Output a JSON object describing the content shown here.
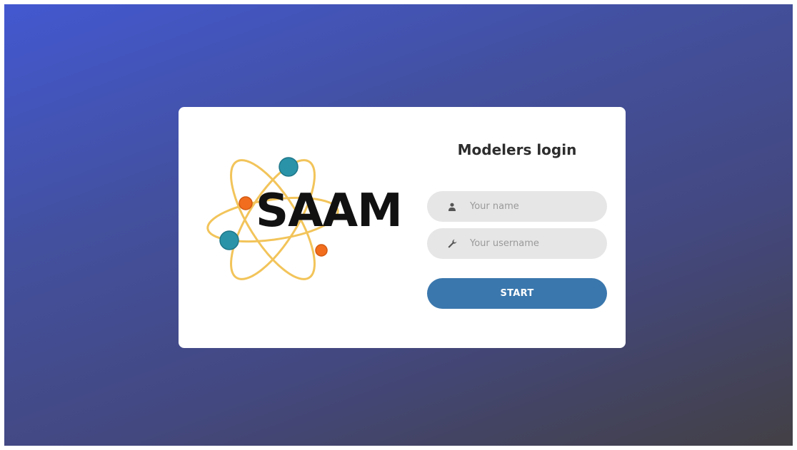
{
  "brand": {
    "logo_text": "SAAM"
  },
  "login": {
    "title": "Modelers login",
    "name_field": {
      "placeholder": "Your name",
      "value": "",
      "icon": "user-icon"
    },
    "username_field": {
      "placeholder": "Your username",
      "value": "",
      "icon": "wrench-icon"
    },
    "start_label": "START"
  },
  "colors": {
    "background_start": "#4358d0",
    "background_end": "#434045",
    "card": "#ffffff",
    "button": "#3a77ad",
    "field": "#e6e6e6",
    "orbit": "#f2c45a",
    "electron_teal": "#2a93a8",
    "electron_orange": "#f26d1d"
  }
}
